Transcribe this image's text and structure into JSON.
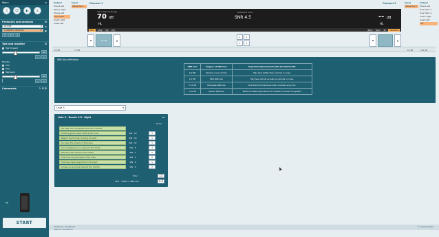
{
  "left": {
    "header": "Menu",
    "icons": [
      "headset-icon",
      "face-icon",
      "speaker-icon",
      "person-icon"
    ],
    "protocols_title": "Protocols and sessions",
    "protocol_value": "ACT/NE",
    "session_value": "CURRENT SESSION",
    "talk_title": "Talk and monitor",
    "talk_forward": "Talk forward",
    "monitor_label": "Monitor",
    "monitor_options": [
      "Ch1",
      "Ch2",
      "Talk back"
    ],
    "comments_title": "Comments",
    "start_label": "START"
  },
  "channel1": {
    "title": "Channel 1",
    "output_head": "Output",
    "outputs": [
      "Phone left",
      "Phone right",
      "Phone left",
      "Free field",
      "Insert right",
      "Insert left"
    ],
    "input_head": "Input",
    "inputs": [
      "Wave file 1"
    ]
  },
  "channel2": {
    "title": "Channel 2",
    "input_head": "Input",
    "inputs": [
      "Wave file 2"
    ],
    "output_head": "Output",
    "outputs": [
      "Phone left",
      "Free Field 1",
      "Free Field 2",
      "Insert right",
      "Insert left",
      "Off"
    ]
  },
  "display": {
    "left_sub": "CH-1 Channel Range",
    "left_level": "70",
    "left_unit": "dB",
    "left_hl": "HL",
    "center_top": "Wideband noise",
    "snr": "SNR 4.5",
    "right_level": "--",
    "right_unit": "dB",
    "right_hl": "HL",
    "left_tags": [
      "Mon",
      "Rev",
      "M",
      "Ctl"
    ],
    "right_tags": [
      "Mon",
      "Rev",
      "M",
      "Mon/Mod"
    ]
  },
  "controls": {
    "left_box": "70 dB",
    "right_box": "--",
    "center_nums": [
      "1",
      "2",
      "3",
      "4"
    ]
  },
  "strip": {
    "left": [
      "-10 dB",
      "70 dB"
    ],
    "right": [
      "-10 dB",
      "120 dB"
    ]
  },
  "definitions": {
    "title": "SNR loss definitions",
    "headers": [
      "SNR loss",
      "Degree of SNR loss",
      "Expected improvement with directional Mic"
    ],
    "rows": [
      [
        "0-2 dB",
        "Normal / near normal",
        "May hear better than normals in noise."
      ],
      [
        "2-7 dB",
        "Mild SNR loss",
        "May hear almost as well as normals in noise."
      ],
      [
        "7-15 dB",
        "Moderate SNR loss",
        "Directional microphones help. Consider array mic."
      ],
      [
        ">15 dB",
        "Severe SNR loss",
        "Maximum SNR improvement is needed. Consider FM system."
      ]
    ]
  },
  "list_select": "Liste 3",
  "sentences": {
    "title": "Liste 3 - Result: 4.5 - Right",
    "score_head": "Score",
    "rows": [
      {
        "text": "His little cat's misdeeds stirs much trouble.",
        "snr": "",
        "score": ""
      },
      {
        "text": "Growing goods need most tender care.",
        "snr": "S/N : 20",
        "score": "3"
      },
      {
        "text": "Regard the hot road cooling at night.",
        "snr": "S/N : 16",
        "score": "1"
      },
      {
        "text": "Go away the wheels in the brass.",
        "snr": "S/N : 12",
        "score": "1"
      },
      {
        "text": "Your compassion is a peace to the heart.",
        "snr": "S/N : 8",
        "score": "3"
      },
      {
        "text": "Wooden pails are the most useful.",
        "snr": "S/N : 4",
        "score": "2"
      },
      {
        "text": "It is a low bicycle travel to the mills.",
        "snr": "S/N : 0",
        "score": "2"
      },
      {
        "text": "The boys have singed fork in the last.",
        "snr": "S/N : 0",
        "score": "1"
      },
      {
        "text": "Arrows are pointing towards the dolphin.",
        "snr": "S/N : 0",
        "score": "2"
      }
    ],
    "total_label": "Total",
    "total_value": "15",
    "formula_label": "25.5 – TOTAL = SNR loss",
    "snr_value": "4.5"
  },
  "status": {
    "left": "Examiner: Sandstrom",
    "left2": "Patient: Sandstrom",
    "right": "© Interacoustics"
  }
}
